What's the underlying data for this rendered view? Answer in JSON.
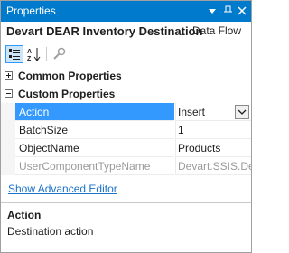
{
  "window": {
    "title": "Properties"
  },
  "object_header": {
    "name": "Devart DEAR Inventory Destination",
    "type": "Data Flow"
  },
  "toolbar": {
    "buttons": [
      "categorized-icon",
      "alphabetical-icon",
      "property-pages-icon"
    ]
  },
  "categories": [
    {
      "label": "Common Properties",
      "expanded": false
    },
    {
      "label": "Custom Properties",
      "expanded": true
    }
  ],
  "properties": [
    {
      "name": "Action",
      "value": "Insert",
      "selected": true,
      "readonly": false
    },
    {
      "name": "BatchSize",
      "value": "1",
      "selected": false,
      "readonly": false
    },
    {
      "name": "ObjectName",
      "value": "Products",
      "selected": false,
      "readonly": false
    },
    {
      "name": "UserComponentTypeName",
      "value": "Devart.SSIS.Dear",
      "selected": false,
      "readonly": true
    }
  ],
  "advanced_editor_link": "Show Advanced Editor",
  "description": {
    "title": "Action",
    "text": "Destination action"
  },
  "colors": {
    "titlebar": "#007acc",
    "selection": "#3399ff",
    "link": "#1a73c8"
  }
}
